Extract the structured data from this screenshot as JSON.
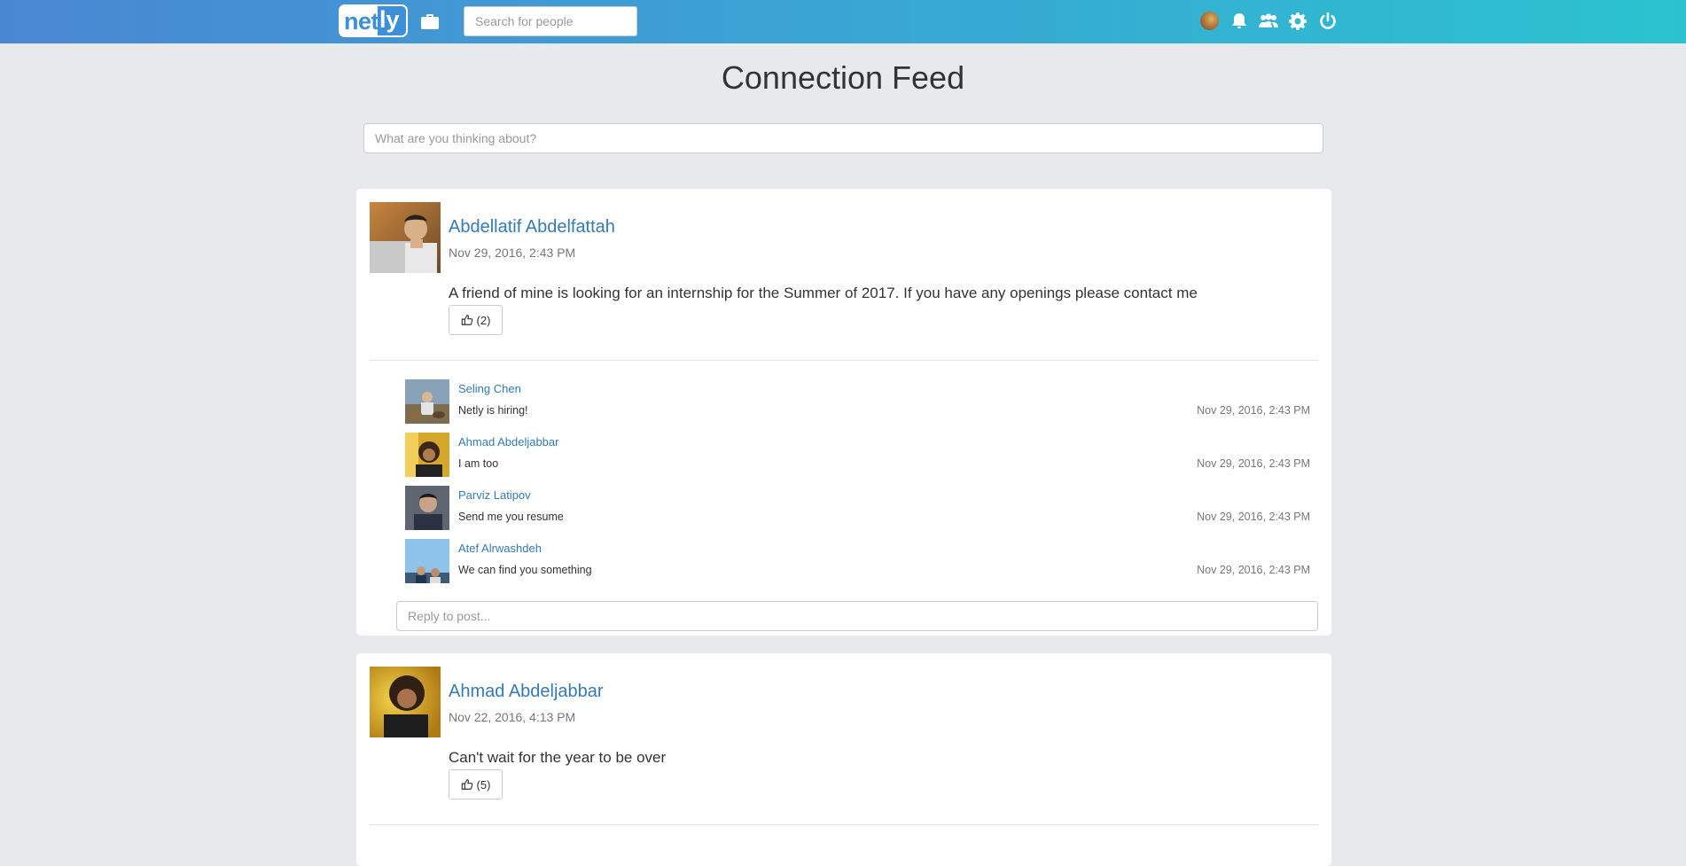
{
  "navbar": {
    "logo_part1": "net",
    "logo_part2": "ly",
    "search_placeholder": "Search for people",
    "icons": [
      "briefcase-icon",
      "avatar",
      "bell-icon",
      "group-icon",
      "gear-icon",
      "power-icon"
    ]
  },
  "page": {
    "title": "Connection Feed",
    "composer_placeholder": "What are you thinking about?"
  },
  "posts": [
    {
      "author": "Abdellatif Abdelfattah",
      "date": "Nov 29, 2016, 2:43 PM",
      "body": "A friend of mine is looking for an internship for the Summer of 2017. If you have any openings please contact me",
      "likes": "(2)",
      "comments": [
        {
          "name": "Seling Chen",
          "text": "Netly is hiring!",
          "date": "Nov 29, 2016, 2:43 PM"
        },
        {
          "name": "Ahmad Abdeljabbar",
          "text": "I am too",
          "date": "Nov 29, 2016, 2:43 PM"
        },
        {
          "name": "Parviz Latipov",
          "text": "Send me you resume",
          "date": "Nov 29, 2016, 2:43 PM"
        },
        {
          "name": "Atef Alrwashdeh",
          "text": "We can find you something",
          "date": "Nov 29, 2016, 2:43 PM"
        }
      ],
      "reply_placeholder": "Reply to post..."
    },
    {
      "author": "Ahmad Abdeljabbar",
      "date": "Nov 22, 2016, 4:13 PM",
      "body": "Can't wait for the year to be over",
      "likes": "(5)"
    }
  ],
  "colors": {
    "nav_gradient_start": "#4a87d3",
    "nav_gradient_end": "#2bc3cf",
    "link": "#337ab7",
    "background": "#e8e9ed"
  }
}
